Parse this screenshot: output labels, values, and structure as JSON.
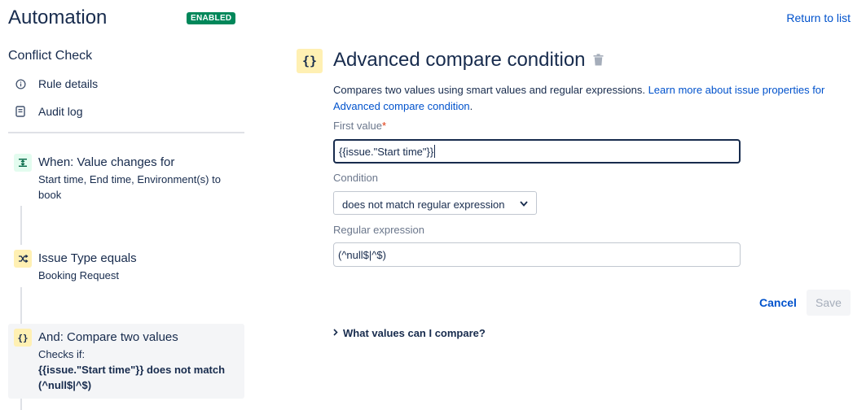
{
  "header": {
    "title": "Automation",
    "status_badge": "ENABLED",
    "return_link": "Return to list"
  },
  "sidebar": {
    "rule_name": "Conflict Check",
    "links": [
      {
        "label": "Rule details",
        "icon": "info-icon"
      },
      {
        "label": "Audit log",
        "icon": "document-icon"
      }
    ],
    "steps": [
      {
        "title": "When: Value changes for",
        "description": "Start time, End time, Environment(s) to book",
        "icon": "trigger-icon"
      },
      {
        "title": "Issue Type equals",
        "description": "Booking Request",
        "icon": "shuffle-icon"
      },
      {
        "title": "And: Compare two values",
        "description": "Checks if:",
        "bold_line1": "{{issue.\"Start time\"}} does not match",
        "bold_line2": "(^null$|^$)",
        "icon": "braces-icon"
      }
    ]
  },
  "main": {
    "icon_glyph": "{}",
    "title": "Advanced compare condition",
    "description_text": "Compares two values using smart values and regular expressions. ",
    "description_link": "Learn more about issue properties for Advanced compare condition",
    "description_end": ".",
    "first_value_label": "First value",
    "required_mark": "*",
    "first_value": "{{issue.\"Start time\"}}",
    "condition_label": "Condition",
    "condition_value": "does not match regular expression",
    "regex_label": "Regular expression",
    "regex_value": "(^null$|^$)",
    "cancel_label": "Cancel",
    "save_label": "Save",
    "expander_label": "What values can I compare?"
  },
  "colors": {
    "accent": "#0052cc",
    "enabled": "#00875a",
    "yellow_icon_bg": "#fff0b3",
    "green_icon_bg": "#e3fcef"
  }
}
